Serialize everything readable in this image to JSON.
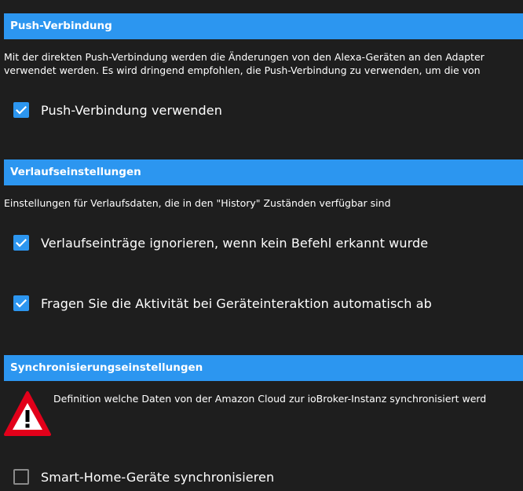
{
  "colors": {
    "background": "#1e1e1e",
    "header": "#2c96f0",
    "checkbox_checked": "#2c96f0",
    "warning_red": "#e2001a"
  },
  "push": {
    "title": "Push-Verbindung",
    "description_line1": "Mit der direkten Push-Verbindung werden die Änderungen von den Alexa-Geräten an den Adapter",
    "description_line2": "verwendet werden. Es wird dringend empfohlen, die Push-Verbindung zu verwenden, um die von",
    "option_label": "Push-Verbindung verwenden",
    "option_checked": true
  },
  "history": {
    "title": "Verlaufseinstellungen",
    "description": "Einstellungen für Verlaufsdaten, die in den \"History\" Zuständen verfügbar sind",
    "options": [
      {
        "label": "Verlaufseinträge ignorieren, wenn kein Befehl erkannt wurde",
        "checked": true
      },
      {
        "label": "Fragen Sie die Aktivität bei Geräteinteraktion automatisch ab",
        "checked": true
      }
    ]
  },
  "sync": {
    "title": "Synchronisierungseinstellungen",
    "warning_icon": "warning-triangle-icon",
    "description": "Definition welche Daten von der Amazon Cloud zur ioBroker-Instanz synchronisiert werd",
    "options": [
      {
        "label": "Smart-Home-Geräte synchronisieren",
        "checked": false
      }
    ]
  }
}
